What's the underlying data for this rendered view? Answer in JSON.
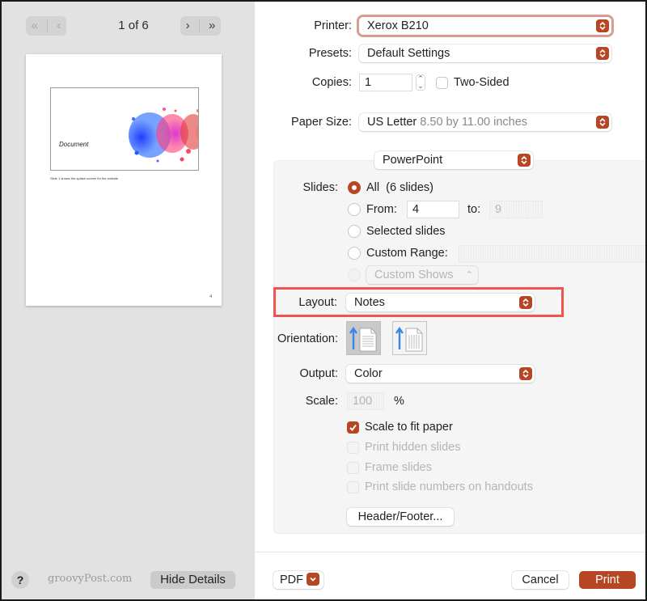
{
  "preview": {
    "page_indicator": "1 of 6",
    "nav": {
      "first_icon": "first-page-icon",
      "prev_icon": "previous-page-icon",
      "next_icon": "next-page-icon",
      "last_icon": "last-page-icon",
      "first_glyph": "«",
      "prev_glyph": "‹",
      "next_glyph": "›",
      "last_glyph": "»"
    },
    "slide_title": "Document",
    "slide_note": "Slide 1 shows the splash screen for the website",
    "page_number": "4"
  },
  "left_footer": {
    "help_label": "?",
    "watermark": "groovyPost.com",
    "hide_details_label": "Hide Details"
  },
  "printer": {
    "label": "Printer:",
    "value": "Xerox B210"
  },
  "presets": {
    "label": "Presets:",
    "value": "Default Settings"
  },
  "copies": {
    "label": "Copies:",
    "value": "1",
    "two_sided_label": "Two-Sided",
    "two_sided_checked": false
  },
  "paper_size": {
    "label": "Paper Size:",
    "value": "US Letter",
    "detail": "8.50 by 11.00 inches"
  },
  "app_section": {
    "value": "PowerPoint"
  },
  "slides": {
    "label": "Slides:",
    "options": [
      {
        "label": "All  (6 slides)",
        "checked": true,
        "disabled": false
      },
      {
        "label": "From:",
        "checked": false,
        "disabled": false
      },
      {
        "label": "Selected slides",
        "checked": false,
        "disabled": false
      },
      {
        "label": "Custom Range:",
        "checked": false,
        "disabled": false
      },
      {
        "label": "",
        "checked": false,
        "disabled": true
      }
    ],
    "from_value": "4",
    "to_label": "to:",
    "to_value": "9",
    "custom_range_value": "",
    "custom_shows": "Custom Shows"
  },
  "layout": {
    "label": "Layout:",
    "value": "Notes"
  },
  "orientation": {
    "label": "Orientation:",
    "options": [
      {
        "name": "portrait",
        "icon": "portrait-orientation-icon",
        "selected": true
      },
      {
        "name": "landscape",
        "icon": "landscape-orientation-icon",
        "selected": false
      }
    ]
  },
  "output": {
    "label": "Output:",
    "value": "Color"
  },
  "scale": {
    "label": "Scale:",
    "value": "100",
    "unit": "%"
  },
  "checkboxes": [
    {
      "label": "Scale to fit paper",
      "checked": true,
      "disabled": false
    },
    {
      "label": "Print hidden slides",
      "checked": false,
      "disabled": true
    },
    {
      "label": "Frame slides",
      "checked": false,
      "disabled": true
    },
    {
      "label": "Print slide numbers on handouts",
      "checked": false,
      "disabled": true
    }
  ],
  "header_footer_label": "Header/Footer...",
  "footer": {
    "pdf_label": "PDF",
    "cancel_label": "Cancel",
    "print_label": "Print"
  },
  "colors": {
    "accent": "#b64624",
    "highlight": "#f0544f",
    "left_pane_bg": "#e1e2e1",
    "settings_box_bg": "#f5f5f5"
  }
}
